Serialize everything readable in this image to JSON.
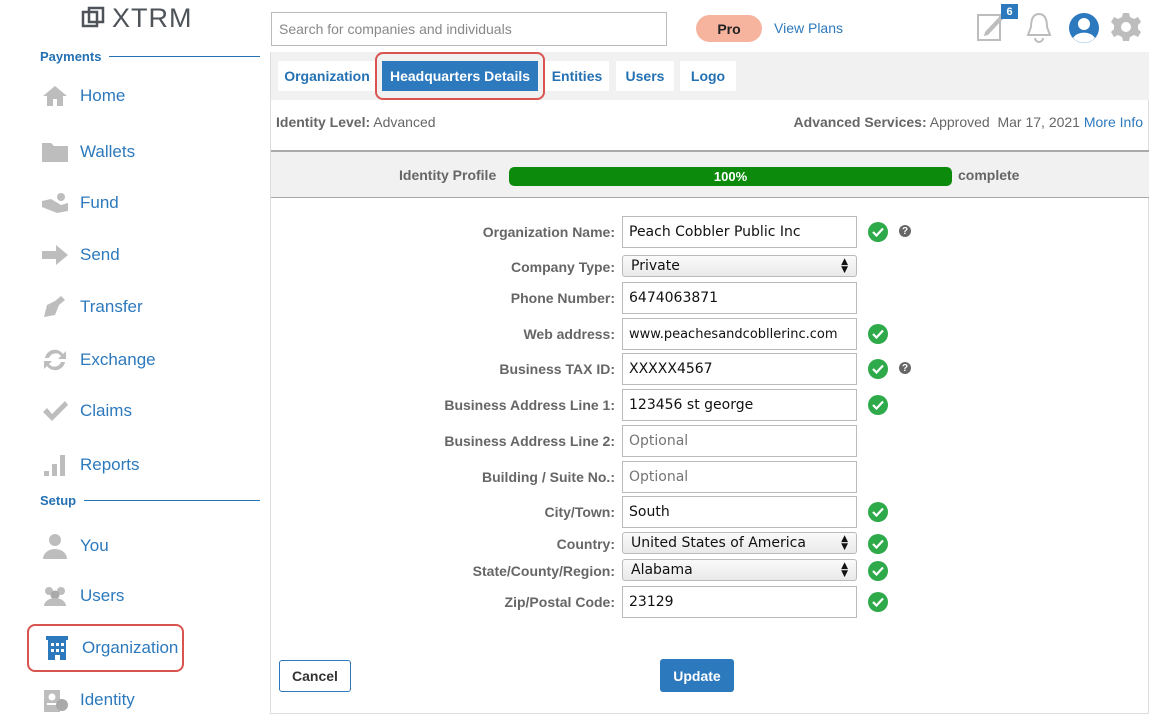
{
  "app": {
    "logo_text": "XTRM"
  },
  "sidebar": {
    "payments_label": "Payments",
    "setup_label": "Setup",
    "items": [
      {
        "label": "Home",
        "icon": "home-icon"
      },
      {
        "label": "Wallets",
        "icon": "folder-icon"
      },
      {
        "label": "Fund",
        "icon": "hand-coin-icon"
      },
      {
        "label": "Send",
        "icon": "arrow-right-icon"
      },
      {
        "label": "Transfer",
        "icon": "transfer-icon"
      },
      {
        "label": "Exchange",
        "icon": "exchange-icon"
      },
      {
        "label": "Claims",
        "icon": "check-icon"
      },
      {
        "label": "Reports",
        "icon": "bar-chart-icon"
      },
      {
        "label": "You",
        "icon": "user-icon"
      },
      {
        "label": "Users",
        "icon": "users-icon"
      },
      {
        "label": "Organization",
        "icon": "building-icon"
      },
      {
        "label": "Identity",
        "icon": "id-icon"
      }
    ]
  },
  "header": {
    "search_placeholder": "Search for companies and individuals",
    "pro_label": "Pro",
    "view_plans": "View Plans",
    "notes_badge": "6"
  },
  "tabs": [
    "Organization",
    "Headquarters Details",
    "Entities",
    "Users",
    "Logo"
  ],
  "identity": {
    "level_label": "Identity Level:",
    "level_value": "Advanced",
    "services_label": "Advanced Services:",
    "services_value": "Approved",
    "services_date": "Mar 17, 2021",
    "more_info": "More Info",
    "profile_label": "Identity Profile",
    "profile_percent": "100%",
    "profile_fraction": 1.0,
    "complete_label": "complete"
  },
  "form": {
    "org_name_label": "Organization Name:",
    "org_name_value": "Peach Cobbler Public Inc",
    "company_type_label": "Company Type:",
    "company_type_value": "Private",
    "phone_label": "Phone Number:",
    "phone_value": "6474063871",
    "web_label": "Web address:",
    "web_value": "www.peachesandcobllerinc.com",
    "tax_label": "Business TAX ID:",
    "tax_value": "XXXXX4567",
    "addr1_label": "Business Address Line 1:",
    "addr1_value": "123456 st george",
    "addr2_label": "Business Address Line 2:",
    "addr2_placeholder": "Optional",
    "suite_label": "Building / Suite No.:",
    "suite_placeholder": "Optional",
    "city_label": "City/Town:",
    "city_value": "South",
    "country_label": "Country:",
    "country_value": "United States of America",
    "state_label": "State/County/Region:",
    "state_value": "Alabama",
    "zip_label": "Zip/Postal Code:",
    "zip_value": "23129",
    "help_glyph": "?"
  },
  "actions": {
    "cancel": "Cancel",
    "update": "Update"
  },
  "colors": {
    "accent": "#2c79bd",
    "success": "#2eaa4a",
    "highlight_ring": "#d9534f",
    "pro_bg": "#f6b49f",
    "progress": "#0b8a0b"
  }
}
